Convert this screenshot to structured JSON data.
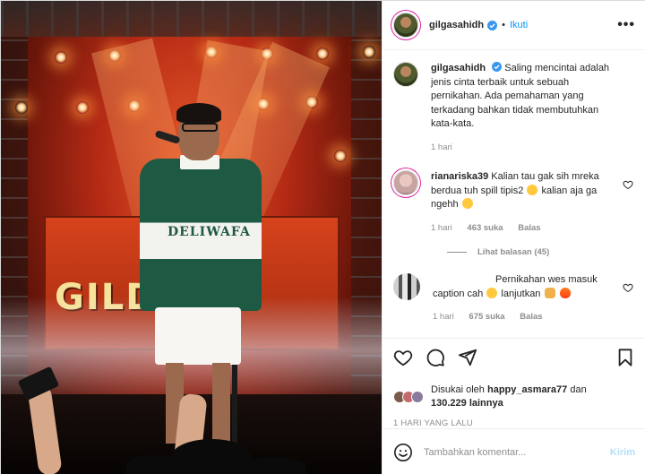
{
  "header": {
    "username": "gilgasahidh",
    "separator": "•",
    "follow_label": "Ikuti",
    "more_label": "•••"
  },
  "photo": {
    "screen_text": "GILDO   IC",
    "shirt_text": "DELIWAFA"
  },
  "caption": {
    "username": "gilgasahidh",
    "text": "Saling mencintai adalah jenis cinta terbaik untuk sebuah pernikahan. Ada pemahaman yang terkadang bahkan tidak membutuhkan kata-kata.",
    "time": "1 hari"
  },
  "comments": [
    {
      "username": "rianariska39",
      "text": "Kalian tau gak sih mreka berdua tuh spill tipis2",
      "text_after": "kalian aja ga ngehh",
      "time": "1 hari",
      "likes": "463 suka",
      "reply_label": "Balas"
    },
    {
      "username": "",
      "text": "Pernikahan wes masuk caption cah",
      "text_after": "lanjutkan",
      "time": "1 hari",
      "likes": "675 suka",
      "reply_label": "Balas"
    }
  ],
  "view_replies_label": "Lihat balasan (45)",
  "likes": {
    "prefix": "Disukai oleh",
    "first_user": "happy_asmara77",
    "conjunction": "dan",
    "others": "130.229 lainnya"
  },
  "post_date": "1 HARI YANG LALU",
  "add_comment": {
    "placeholder": "Tambahkan komentar...",
    "post_label": "Kirim"
  },
  "colors": {
    "accent": "#0095f6",
    "post_disabled": "#b2dffc",
    "muted": "#8e8e8e"
  },
  "icons": [
    "verified-icon",
    "more-icon",
    "heart-icon",
    "comment-icon",
    "share-icon",
    "bookmark-icon",
    "emoji-icon"
  ]
}
